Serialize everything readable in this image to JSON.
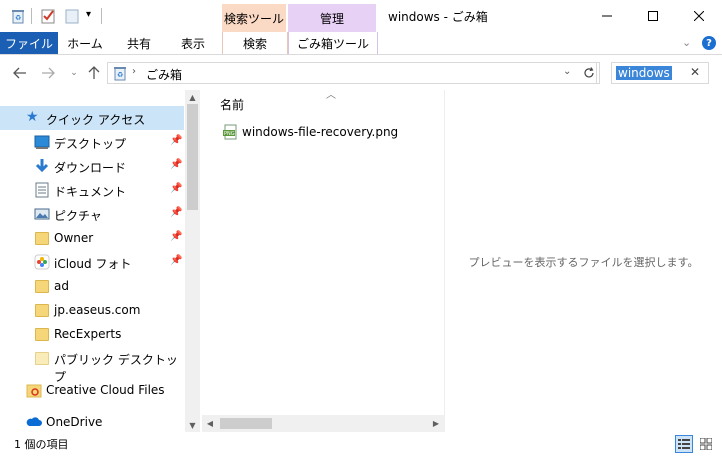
{
  "window": {
    "title": "windows - ごみ箱",
    "contextual_tabs": [
      {
        "group": "検索ツール",
        "tab": "検索",
        "color": "#fad9c5"
      },
      {
        "group": "管理",
        "tab": "ごみ箱ツール",
        "color": "#e7d1f5"
      }
    ]
  },
  "ribbon": {
    "file_tab": "ファイル",
    "tabs": [
      "ホーム",
      "共有",
      "表示"
    ]
  },
  "address": {
    "path": "ごみ箱"
  },
  "search": {
    "value": "windows"
  },
  "nav": {
    "quick_access": "クイック アクセス",
    "items": [
      {
        "label": "デスクトップ",
        "icon": "desktop-icon",
        "pinned": true
      },
      {
        "label": "ダウンロード",
        "icon": "download-icon",
        "pinned": true
      },
      {
        "label": "ドキュメント",
        "icon": "document-icon",
        "pinned": true
      },
      {
        "label": "ピクチャ",
        "icon": "picture-icon",
        "pinned": true
      },
      {
        "label": "Owner",
        "icon": "folder-icon",
        "pinned": true
      },
      {
        "label": "iCloud フォト",
        "icon": "icloud-photos-icon",
        "pinned": true
      },
      {
        "label": "ad",
        "icon": "folder-icon",
        "pinned": false
      },
      {
        "label": "jp.easeus.com",
        "icon": "folder-icon",
        "pinned": false
      },
      {
        "label": "RecExperts",
        "icon": "folder-icon",
        "pinned": false
      },
      {
        "label": "パブリック デスクトップ",
        "icon": "folder-icon",
        "pinned": false
      }
    ],
    "creative_cloud": "Creative Cloud Files",
    "onedrive": "OneDrive"
  },
  "content": {
    "column_name": "名前",
    "files": [
      {
        "name": "windows-file-recovery.png",
        "icon": "png-file-icon"
      }
    ]
  },
  "preview": {
    "message": "プレビューを表示するファイルを選択します。"
  },
  "status": {
    "count": "1 個の項目"
  }
}
